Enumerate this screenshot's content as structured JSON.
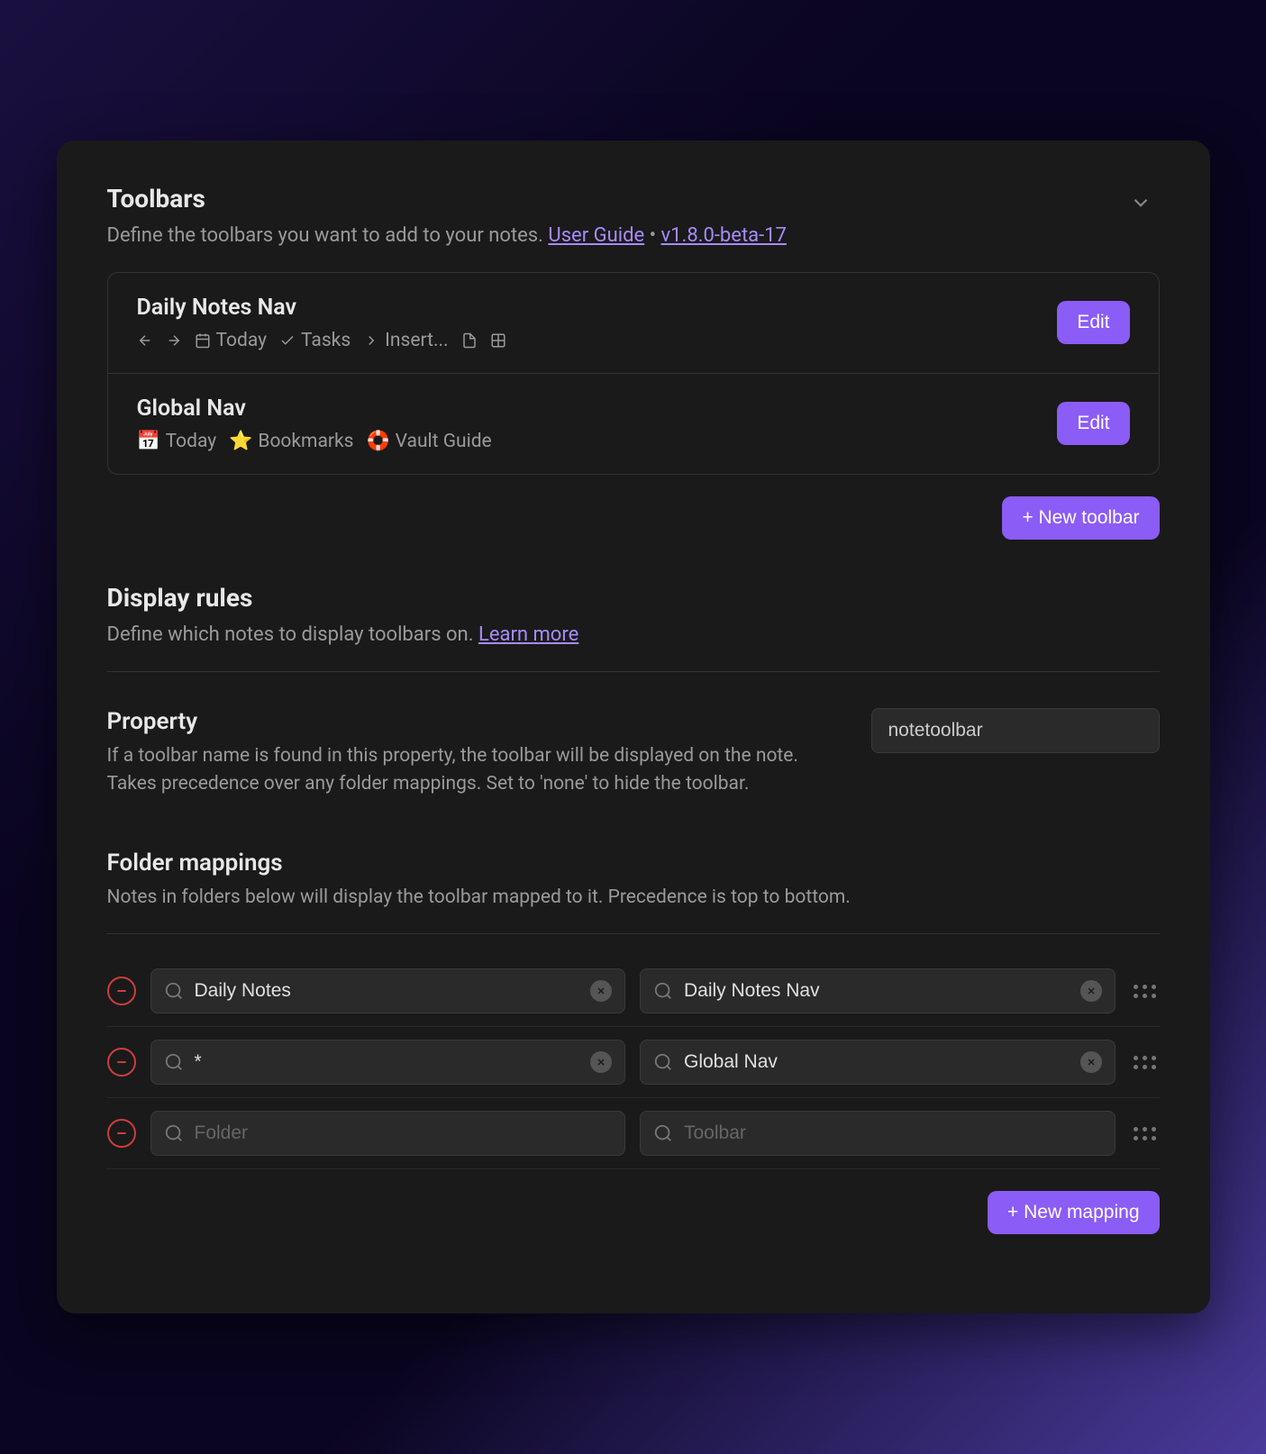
{
  "toolbars": {
    "title": "Toolbars",
    "subtitle_prefix": "Define the toolbars you want to add to your notes. ",
    "user_guide_link": "User Guide",
    "separator": " • ",
    "version_link": "v1.8.0-beta-17",
    "items": [
      {
        "name": "Daily Notes Nav",
        "preview": [
          {
            "icon": "arrow-left",
            "label": ""
          },
          {
            "icon": "arrow-right",
            "label": ""
          },
          {
            "icon": "calendar",
            "label": "Today"
          },
          {
            "icon": "check",
            "label": "Tasks"
          },
          {
            "icon": "chevron-right",
            "label": "Insert..."
          },
          {
            "icon": "file",
            "label": ""
          },
          {
            "icon": "layout",
            "label": ""
          }
        ],
        "edit_label": "Edit"
      },
      {
        "name": "Global Nav",
        "preview": [
          {
            "emoji": "📅",
            "label": "Today"
          },
          {
            "emoji": "⭐",
            "label": "Bookmarks"
          },
          {
            "emoji": "🛟",
            "label": "Vault Guide"
          }
        ],
        "edit_label": "Edit"
      }
    ],
    "new_toolbar_label": "+ New toolbar"
  },
  "display_rules": {
    "title": "Display rules",
    "subtitle_prefix": "Define which notes to display toolbars on. ",
    "learn_more_link": "Learn more"
  },
  "property": {
    "title": "Property",
    "help": "If a toolbar name is found in this property, the toolbar will be displayed on the note. Takes precedence over any folder mappings. Set to 'none' to hide the toolbar.",
    "value": "notetoolbar"
  },
  "folder_mappings": {
    "title": "Folder mappings",
    "help": "Notes in folders below will display the toolbar mapped to it. Precedence is top to bottom.",
    "folder_placeholder": "Folder",
    "toolbar_placeholder": "Toolbar",
    "rows": [
      {
        "folder": "Daily Notes",
        "toolbar": "Daily Notes Nav"
      },
      {
        "folder": "*",
        "toolbar": "Global Nav"
      },
      {
        "folder": "",
        "toolbar": ""
      }
    ],
    "new_mapping_label": "+ New mapping"
  }
}
